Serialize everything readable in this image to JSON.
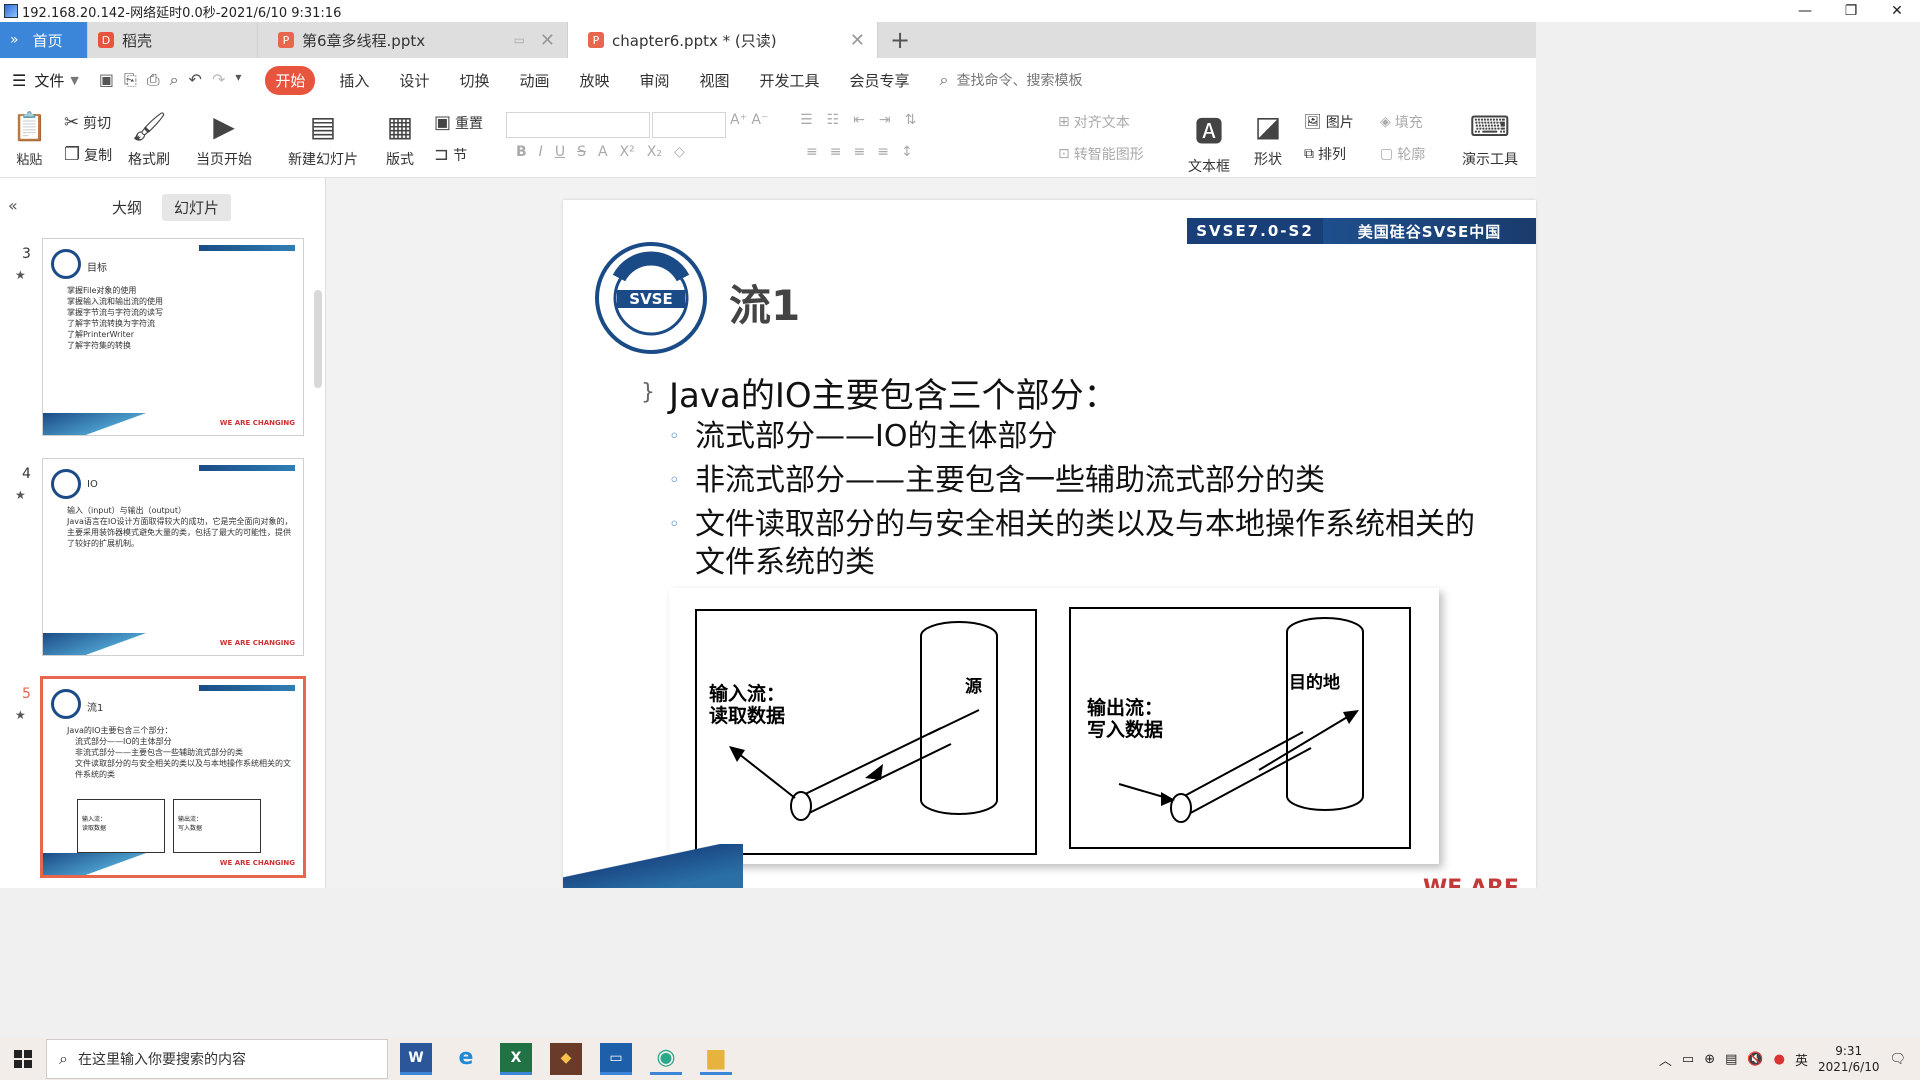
{
  "window": {
    "title": "192.168.20.142-网络延时0.0秒-2021/6/10 9:31:16",
    "min": "—",
    "max": "❐",
    "close": "✕"
  },
  "tabs": [
    {
      "label": "首页",
      "icon": "home-icon"
    },
    {
      "label": "稻壳",
      "icon": "daoke-icon"
    },
    {
      "label": "第6章多线程.pptx",
      "icon": "ppt-icon"
    },
    {
      "label": "chapter6.pptx * (只读)",
      "icon": "ppt-icon"
    }
  ],
  "tab_add": "+",
  "menu": {
    "file": "文件",
    "items": [
      "开始",
      "插入",
      "设计",
      "切换",
      "动画",
      "放映",
      "审阅",
      "视图",
      "开发工具",
      "会员专享"
    ],
    "active": "开始",
    "search": "查找命令、搜索模板"
  },
  "toolbar": {
    "paste": "粘贴",
    "cut": "剪切",
    "copy": "复制",
    "format_painter": "格式刷",
    "from_current": "当页开始",
    "new_slide": "新建幻灯片",
    "layout": "版式",
    "section": "节",
    "reset": "重置",
    "align_text": "对齐文本",
    "smart_shape": "转智能图形",
    "textbox": "文本框",
    "shape": "形状",
    "picture": "图片",
    "arrange": "排列",
    "fill": "填充",
    "outline": "轮廓",
    "present_tools": "演示工具"
  },
  "leftpane": {
    "outline_tab": "大纲",
    "slides_tab": "幻灯片",
    "thumbs": [
      {
        "num": "3",
        "title": "目标",
        "lines": [
          "掌握File对象的使用",
          "掌握输入流和输出流的使用",
          "掌握字节流与字符流的读写",
          "了解字节流转换为字符流",
          "了解PrinterWriter",
          "了解字符集的转换"
        ]
      },
      {
        "num": "4",
        "title": "IO",
        "lines": [
          "输入（input）与输出（output）",
          "Java语言在IO设计方面取得较大的成功，它是完全面向对象的，主要采用装饰器模式避免大量的类，包括了最大的可能性，提供了较好的扩展机制。"
        ]
      },
      {
        "num": "5",
        "title": "流1",
        "lines": [
          "Java的IO主要包含三个部分：",
          "流式部分——IO的主体部分",
          "非流式部分——主要包含一些辅助流式部分的类",
          "文件读取部分的与安全相关的类以及与本地操作系统相关的文件系统的类"
        ]
      }
    ],
    "footer_text": "WE ARE CHANGING"
  },
  "slide": {
    "banner_left": "SVSE7.0-S2",
    "banner_right": "美国硅谷SVSE中国",
    "logo_text": "SVSE",
    "logo_ring": "SILICON VALLEY SOFTWARE ENGINEER",
    "title": "流1",
    "bullet_main": "Java的IO主要包含三个部分：",
    "bullets": [
      "流式部分——IO的主体部分",
      "非流式部分——主要包含一些辅助流式部分的类",
      "文件读取部分的与安全相关的类以及与本地操作系统相关的文件系统的类"
    ],
    "figure": {
      "left_label_1": "输入流：",
      "left_label_2": "读取数据",
      "left_source": "源",
      "right_label_1": "输出流：",
      "right_label_2": "写入数据",
      "right_dest": "目的地"
    },
    "footer_text": "WE ARE"
  },
  "taskbar": {
    "search_placeholder": "在这里输入你要搜索的内容",
    "time": "9:31",
    "date": "2021/6/10",
    "ime": "英",
    "apps": [
      "word-icon",
      "edge-icon",
      "excel-icon",
      "app-icon",
      "remote-desktop-icon",
      "browser-icon",
      "folder-icon"
    ]
  }
}
